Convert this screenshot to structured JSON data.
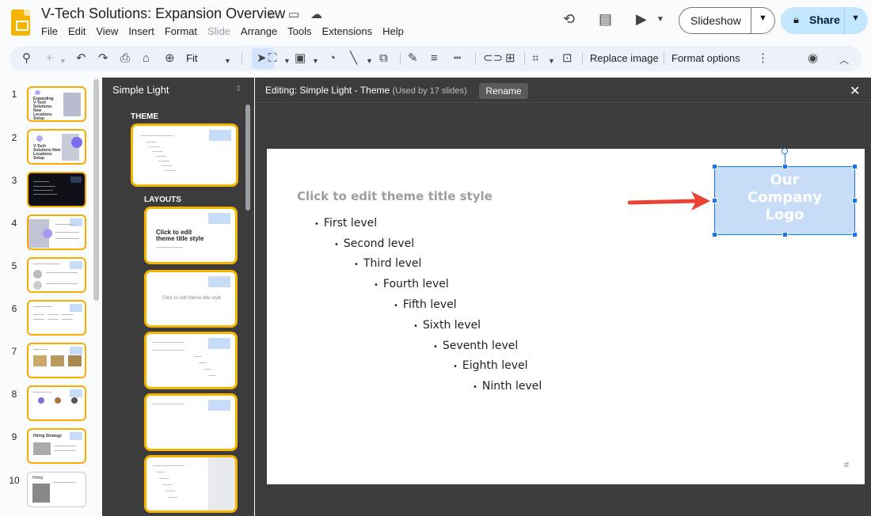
{
  "header": {
    "doc_title": "V-Tech Solutions: Expansion Overview",
    "menu": [
      "File",
      "Edit",
      "View",
      "Insert",
      "Format",
      "Slide",
      "Arrange",
      "Tools",
      "Extensions",
      "Help"
    ],
    "slideshow_label": "Slideshow",
    "share_label": "Share"
  },
  "toolbar": {
    "zoom": "Fit",
    "replace_image": "Replace image",
    "format_options": "Format options"
  },
  "filmstrip": {
    "slides": [
      {
        "num": "1",
        "text": "Expanding V-Tech Solutions: New Locations Setup"
      },
      {
        "num": "2",
        "text": "V-Tech Solutions New Locations Setup"
      },
      {
        "num": "3",
        "text": ""
      },
      {
        "num": "4",
        "text": ""
      },
      {
        "num": "5",
        "text": ""
      },
      {
        "num": "6",
        "text": ""
      },
      {
        "num": "7",
        "text": ""
      },
      {
        "num": "8",
        "text": ""
      },
      {
        "num": "9",
        "text": "Hiring Strategy"
      },
      {
        "num": "10",
        "text": "Hiring"
      }
    ]
  },
  "theme_panel": {
    "theme_name": "Simple Light",
    "theme_heading": "THEME",
    "layouts_heading": "LAYOUTS",
    "layout_title_text": "Click to edit theme title style",
    "layout_center_text": "Click to edit theme title style"
  },
  "editor": {
    "editing_prefix": "Editing: Simple Light - Theme",
    "used_by": "(Used by 17 slides)",
    "rename_label": "Rename",
    "slide_title": "Click to edit theme title style",
    "levels": [
      "First level",
      "Second level",
      "Third level",
      "Fourth level",
      "Fifth level",
      "Sixth level",
      "Seventh level",
      "Eighth level",
      "Ninth level"
    ],
    "logo_text": "Our\nCompany\nLogo",
    "page_number": "#"
  },
  "colors": {
    "accent": "#1a73e8",
    "thumb_border": "#f4b400",
    "share_bg": "#c2e7ff",
    "arrow": "#ea4335",
    "logo_fill": "#c6dcf7"
  }
}
